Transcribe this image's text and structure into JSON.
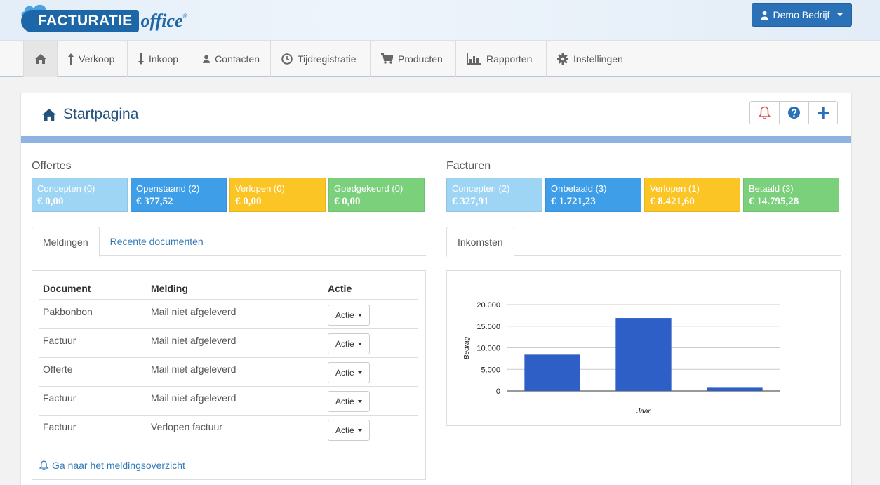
{
  "app": {
    "logo_main": "FACTURATIE",
    "logo_office": "office",
    "logo_reg": "®"
  },
  "user_menu": {
    "label": "Demo Bedrijf"
  },
  "nav": {
    "items": [
      {
        "label": "",
        "icon": "home-icon"
      },
      {
        "label": "Verkoop",
        "icon": "arrow-up-icon"
      },
      {
        "label": "Inkoop",
        "icon": "arrow-down-icon"
      },
      {
        "label": "Contacten",
        "icon": "user-icon"
      },
      {
        "label": "Tijdregistratie",
        "icon": "clock-icon"
      },
      {
        "label": "Producten",
        "icon": "cart-icon"
      },
      {
        "label": "Rapporten",
        "icon": "bar-chart-icon"
      },
      {
        "label": "Instellingen",
        "icon": "gear-icon"
      }
    ]
  },
  "page": {
    "title": "Startpagina"
  },
  "offertes": {
    "label": "Offertes",
    "tiles": [
      {
        "label": "Concepten (0)",
        "value": "€ 0,00"
      },
      {
        "label": "Openstaand (2)",
        "value": "€ 377,52"
      },
      {
        "label": "Verlopen (0)",
        "value": "€ 0,00"
      },
      {
        "label": "Goedgekeurd (0)",
        "value": "€ 0,00"
      }
    ]
  },
  "facturen": {
    "label": "Facturen",
    "tiles": [
      {
        "label": "Concepten (2)",
        "value": "€ 327,91"
      },
      {
        "label": "Onbetaald (3)",
        "value": "€ 1.721,23"
      },
      {
        "label": "Verlopen (1)",
        "value": "€ 8.421,60"
      },
      {
        "label": "Betaald (3)",
        "value": "€ 14.795,28"
      }
    ]
  },
  "left_tabs": [
    "Meldingen",
    "Recente documenten"
  ],
  "meldingen": {
    "headers": [
      "Document",
      "Melding",
      "Actie"
    ],
    "rows": [
      {
        "document": "Pakbonbon",
        "melding": "Mail niet afgeleverd",
        "actie": "Actie"
      },
      {
        "document": "Factuur",
        "melding": "Mail niet afgeleverd",
        "actie": "Actie"
      },
      {
        "document": "Offerte",
        "melding": "Mail niet afgeleverd",
        "actie": "Actie"
      },
      {
        "document": "Factuur",
        "melding": "Mail niet afgeleverd",
        "actie": "Actie"
      },
      {
        "document": "Factuur",
        "melding": "Verlopen factuur",
        "actie": "Actie"
      }
    ],
    "link": "Ga naar het meldingsoverzicht"
  },
  "right_tabs": [
    "Inkomsten"
  ],
  "colors": {
    "bar": "#2e5fc6",
    "accent": "#2a71b8"
  },
  "chart_data": {
    "type": "bar",
    "categories": [
      "",
      "",
      ""
    ],
    "values": [
      8400,
      16900,
      750
    ],
    "xlabel": "Jaar",
    "ylabel": "Bedrag",
    "ylim": [
      0,
      20000
    ],
    "yticks": [
      "0",
      "5.000",
      "10.000",
      "15.000",
      "20.000"
    ],
    "grid": true
  }
}
